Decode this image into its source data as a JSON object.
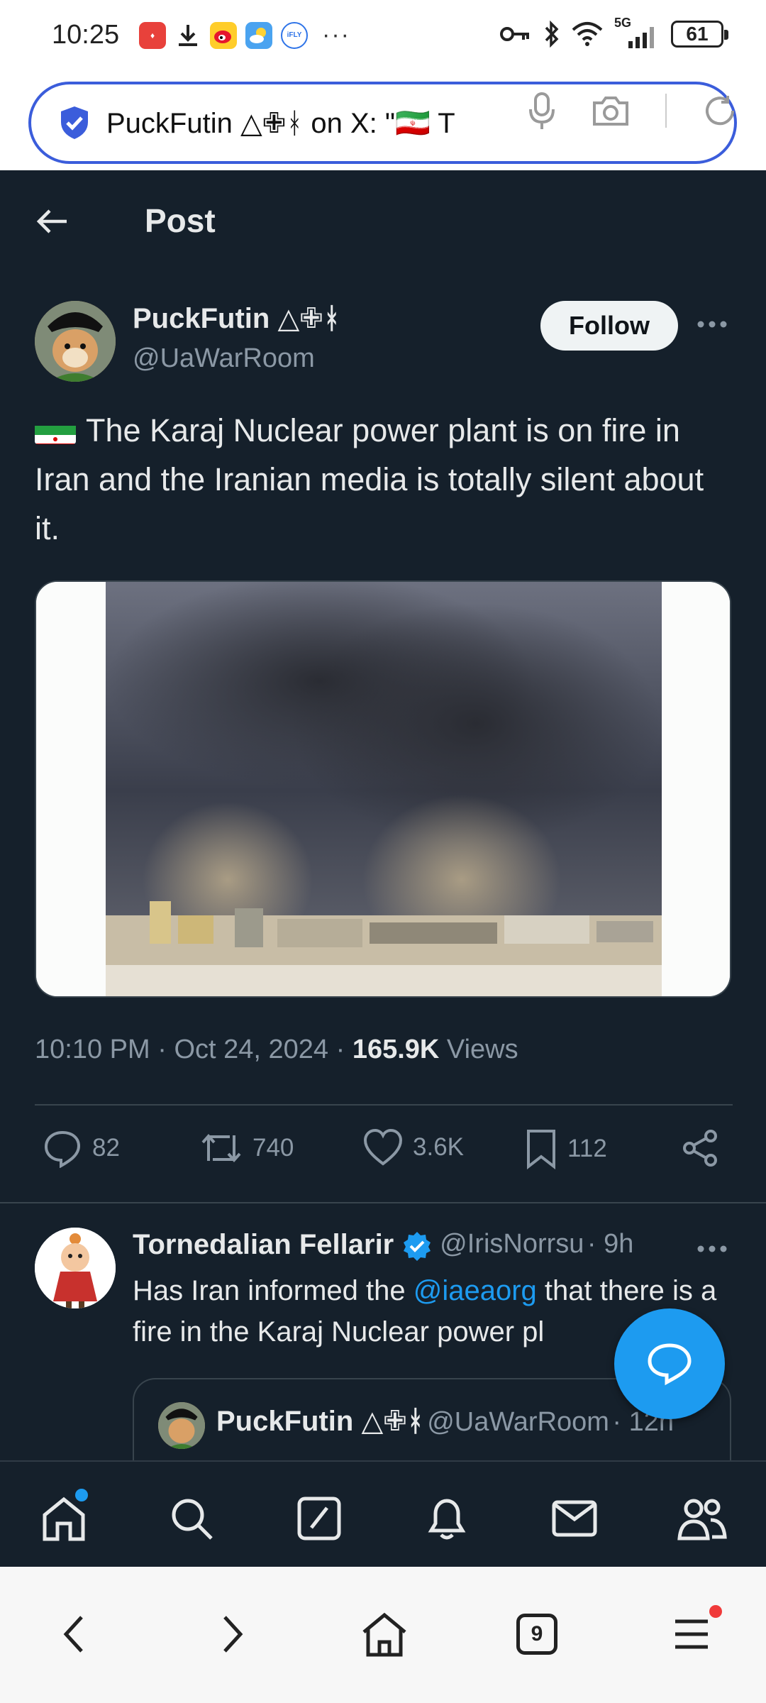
{
  "status_bar": {
    "time": "10:25",
    "battery": "61",
    "network": "5G",
    "more": "···"
  },
  "browser": {
    "url_text": "PuckFutin △✙ᚼ on X: \"🇮🇷 T",
    "tab_count": "9"
  },
  "header": {
    "title": "Post"
  },
  "post": {
    "author_name": "PuckFutin △✙ᚼ",
    "author_handle": "@UaWarRoom",
    "follow_label": "Follow",
    "text": "The Karaj Nuclear power plant is on fire in Iran and the Iranian media is totally silent about it.",
    "time": "10:10 PM",
    "date": "Oct 24, 2024",
    "views_count": "165.9K",
    "views_label": "Views",
    "replies": "82",
    "reposts": "740",
    "likes": "3.6K",
    "bookmarks": "112"
  },
  "reply": {
    "author_name": "Tornedalian Fellarir",
    "author_handle": "@IrisNorrsu",
    "age": "9h",
    "text_before": "Has Iran informed the ",
    "mention": "@iaeaorg",
    "text_after": "  that there is a fire in the Karaj Nuclear power pl",
    "quote_author": "PuckFutin △✙ᚼ",
    "quote_handle": "@UaWarRoom",
    "quote_age": "12h"
  },
  "colors": {
    "background": "#15202b",
    "accent": "#1d9bf0",
    "text_primary": "#e7e9ea",
    "text_secondary": "#8b98a5"
  }
}
